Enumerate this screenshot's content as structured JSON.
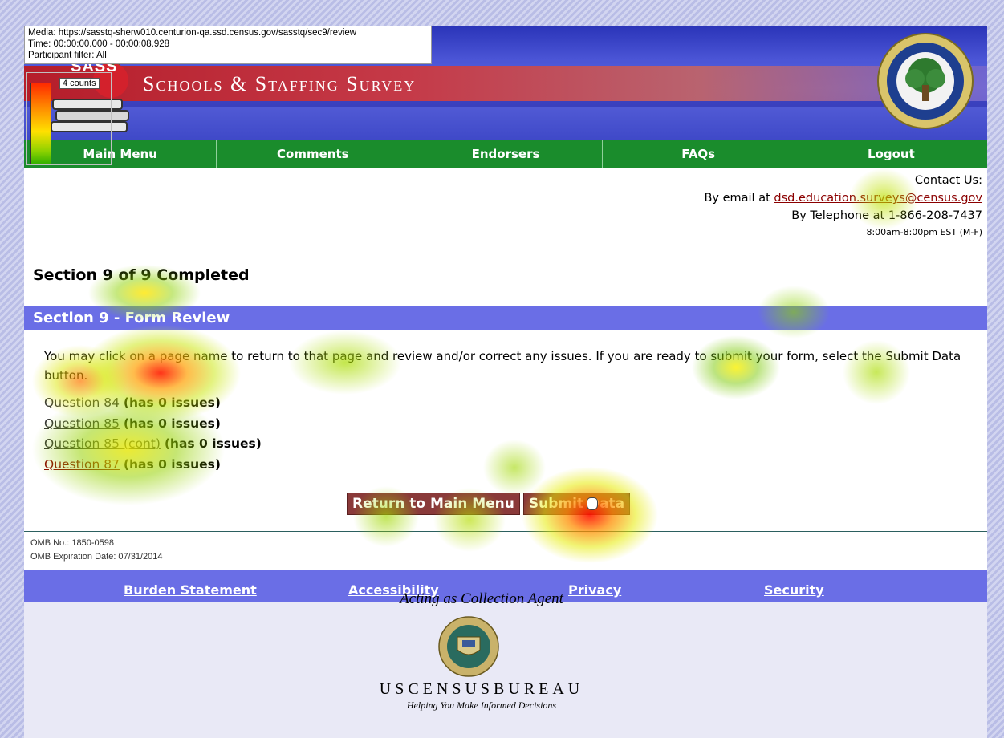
{
  "overlay": {
    "media": "Media: https://sasstq-sherw010.centurion-qa.ssd.census.gov/sasstq/sec9/review",
    "time": "Time: 00:00:00.000 - 00:00:08.928",
    "filter": "Participant filter: All",
    "count": "4 counts"
  },
  "header": {
    "logo_text": "SASS",
    "title": "Schools & Staffing Survey",
    "seal": "department-of-education-seal"
  },
  "nav": {
    "items": [
      "Main Menu",
      "Comments",
      "Endorsers",
      "FAQs",
      "Logout"
    ]
  },
  "contact": {
    "heading": "Contact Us:",
    "email_prefix": "By email at ",
    "email": "dsd.education.surveys@census.gov",
    "phone": "By Telephone at 1-866-208-7437",
    "hours": "8:00am-8:00pm EST (M-F)"
  },
  "section": {
    "status": "Section 9 of 9 Completed",
    "bar_title": "Section 9 - Form Review",
    "instructions": "You may click on a page name to return to that page and review and/or correct any issues. If you are ready to submit your form, select the Submit Data button."
  },
  "questions": [
    {
      "link": "Question 84",
      "issues": "(has 0 issues)"
    },
    {
      "link": "Question 85",
      "issues": "(has 0 issues)"
    },
    {
      "link": "Question 85 (cont)",
      "issues": "(has 0 issues)"
    },
    {
      "link": "Question 87",
      "issues": "(has 0 issues)"
    }
  ],
  "buttons": {
    "return": "Return to Main Menu",
    "submit": "Submit Data"
  },
  "omb": {
    "number": "OMB No.: 1850-0598",
    "expiration": "OMB Expiration Date: 07/31/2014"
  },
  "footer": {
    "links": [
      "Burden Statement",
      "Accessibility",
      "Privacy",
      "Security"
    ],
    "agent": "Acting as Collection Agent",
    "census_name": "USCENSUSBUREAU",
    "census_tag": "Helping You Make Informed Decisions"
  },
  "colors": {
    "nav_green": "#1a8c2c",
    "section_purple": "#6a6ee6",
    "button_maroon": "#8a3a3a",
    "link_red": "#8b0000"
  }
}
